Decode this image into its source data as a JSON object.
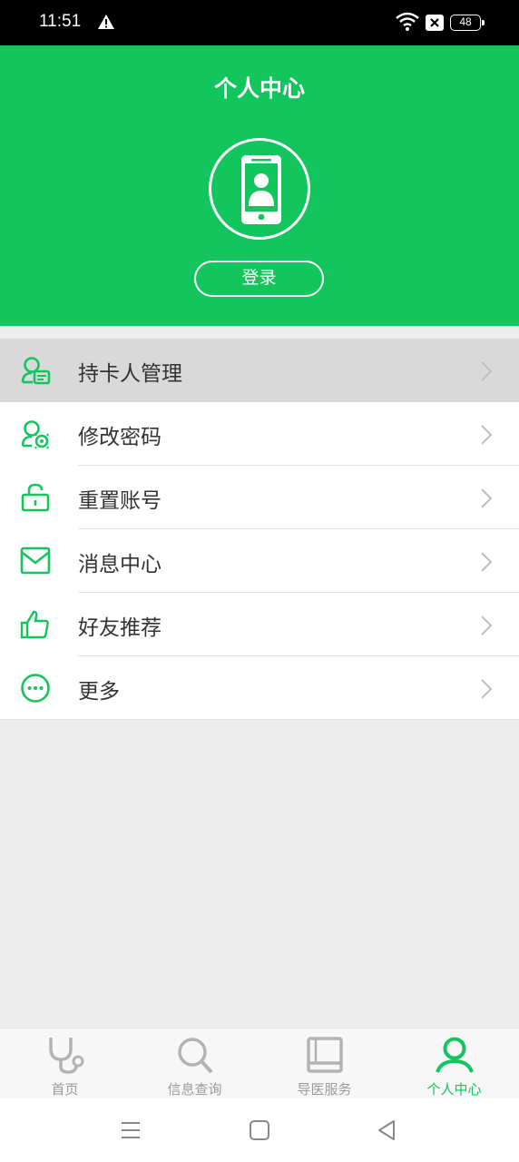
{
  "status_bar": {
    "time": "11:51",
    "battery": "48",
    "icons": [
      "warning-icon",
      "wifi-icon",
      "no-sim-icon",
      "battery-icon"
    ]
  },
  "header": {
    "title": "个人中心",
    "avatar_icon": "phone-user-icon",
    "login_label": "登录",
    "background_color": "#13c55d"
  },
  "menu": {
    "items": [
      {
        "label": "持卡人管理",
        "icon": "cardholder-icon",
        "highlighted": true
      },
      {
        "label": "修改密码",
        "icon": "user-key-icon",
        "highlighted": false
      },
      {
        "label": "重置账号",
        "icon": "unlock-icon",
        "highlighted": false
      },
      {
        "label": "消息中心",
        "icon": "mail-icon",
        "highlighted": false
      },
      {
        "label": "好友推荐",
        "icon": "thumbs-up-icon",
        "highlighted": false
      },
      {
        "label": "更多",
        "icon": "more-icon",
        "highlighted": false
      }
    ]
  },
  "tab_bar": {
    "tabs": [
      {
        "label": "首页",
        "icon": "stethoscope-icon",
        "active": false
      },
      {
        "label": "信息查询",
        "icon": "search-icon",
        "active": false
      },
      {
        "label": "导医服务",
        "icon": "book-icon",
        "active": false
      },
      {
        "label": "个人中心",
        "icon": "person-icon",
        "active": true
      }
    ],
    "active_color": "#13c55d",
    "inactive_color": "#9a9a9a"
  },
  "nav_bar": {
    "buttons": [
      "menu-icon",
      "home-icon",
      "back-icon"
    ]
  }
}
